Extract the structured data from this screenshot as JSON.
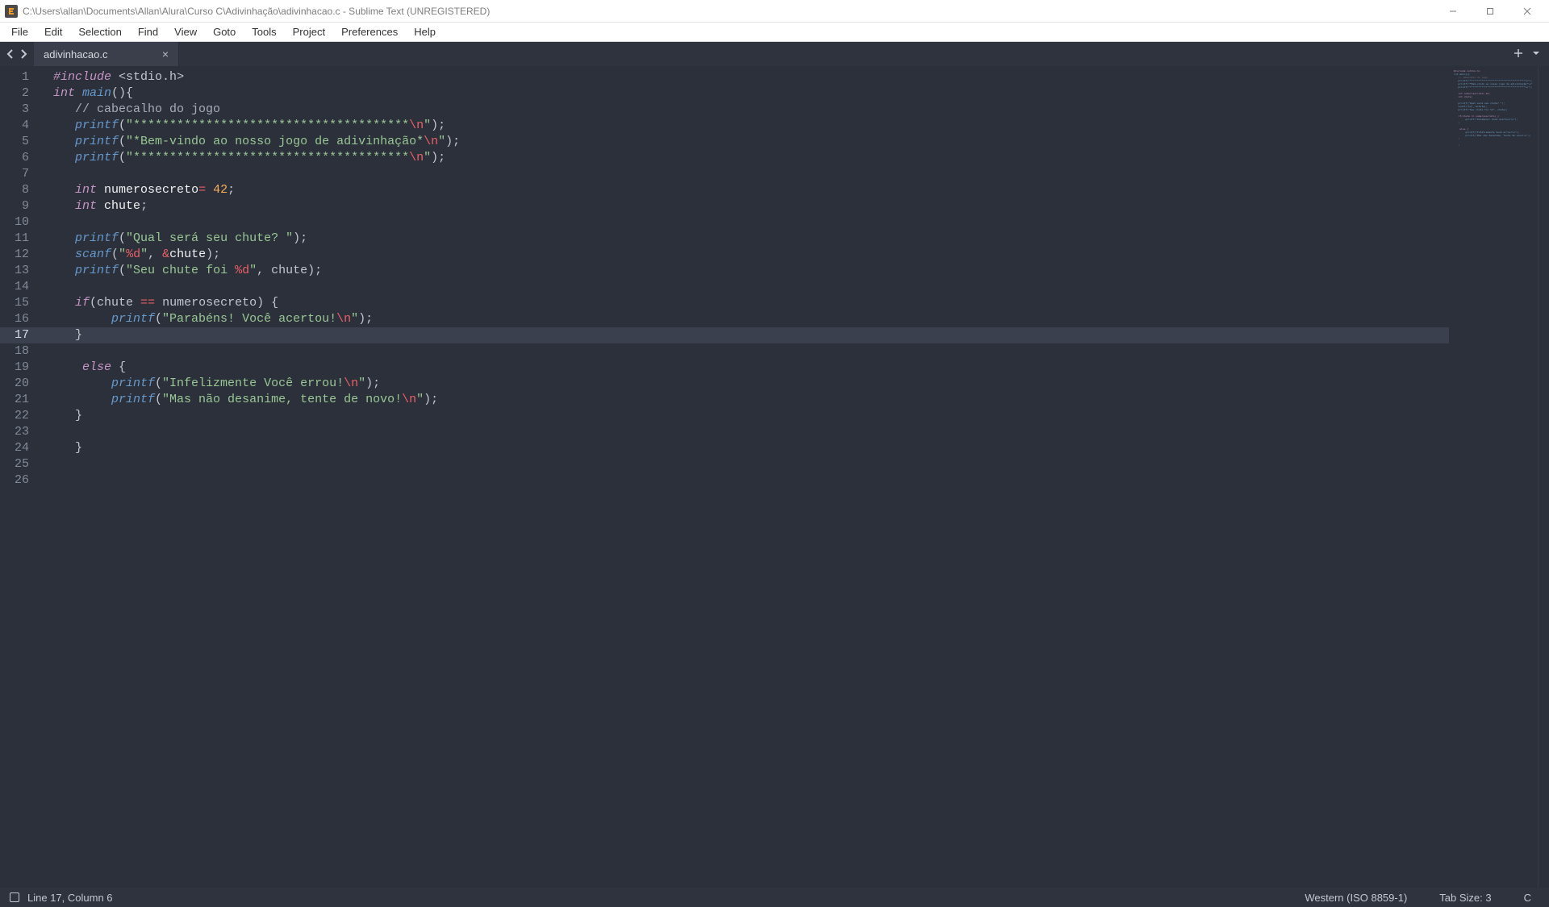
{
  "window": {
    "title": "C:\\Users\\allan\\Documents\\Allan\\Alura\\Curso C\\Adivinhação\\adivinhacao.c - Sublime Text (UNREGISTERED)"
  },
  "menu": {
    "items": [
      "File",
      "Edit",
      "Selection",
      "Find",
      "View",
      "Goto",
      "Tools",
      "Project",
      "Preferences",
      "Help"
    ]
  },
  "tabs": {
    "active": {
      "label": "adivinhacao.c"
    }
  },
  "editor": {
    "line_count": 26,
    "current_line": 17,
    "code_tokens": [
      [
        {
          "c": "pre",
          "t": "#include"
        },
        {
          "c": "pun",
          "t": " "
        },
        {
          "c": "pun",
          "t": "<"
        },
        {
          "c": "inc",
          "t": "stdio.h"
        },
        {
          "c": "pun",
          "t": ">"
        }
      ],
      [
        {
          "c": "kw",
          "t": "int"
        },
        {
          "c": "pun",
          "t": " "
        },
        {
          "c": "fn",
          "t": "main"
        },
        {
          "c": "pun",
          "t": "(){"
        }
      ],
      [
        {
          "c": "pun",
          "t": "   "
        },
        {
          "c": "cmt",
          "t": "// cabecalho do jogo"
        }
      ],
      [
        {
          "c": "pun",
          "t": "   "
        },
        {
          "c": "fn",
          "t": "printf"
        },
        {
          "c": "pun",
          "t": "("
        },
        {
          "c": "str",
          "t": "\"**************************************"
        },
        {
          "c": "esc",
          "t": "\\n"
        },
        {
          "c": "str",
          "t": "\""
        },
        {
          "c": "pun",
          "t": ");"
        }
      ],
      [
        {
          "c": "pun",
          "t": "   "
        },
        {
          "c": "fn",
          "t": "printf"
        },
        {
          "c": "pun",
          "t": "("
        },
        {
          "c": "str",
          "t": "\"*Bem-vindo ao nosso jogo de adivinhação*"
        },
        {
          "c": "esc",
          "t": "\\n"
        },
        {
          "c": "str",
          "t": "\""
        },
        {
          "c": "pun",
          "t": ");"
        }
      ],
      [
        {
          "c": "pun",
          "t": "   "
        },
        {
          "c": "fn",
          "t": "printf"
        },
        {
          "c": "pun",
          "t": "("
        },
        {
          "c": "str",
          "t": "\"**************************************"
        },
        {
          "c": "esc",
          "t": "\\n"
        },
        {
          "c": "str",
          "t": "\""
        },
        {
          "c": "pun",
          "t": ");"
        }
      ],
      [],
      [
        {
          "c": "pun",
          "t": "   "
        },
        {
          "c": "kw",
          "t": "int"
        },
        {
          "c": "pun",
          "t": " "
        },
        {
          "c": "ident",
          "t": "numerosecreto"
        },
        {
          "c": "op",
          "t": "="
        },
        {
          "c": "pun",
          "t": " "
        },
        {
          "c": "num",
          "t": "42"
        },
        {
          "c": "pun",
          "t": ";"
        }
      ],
      [
        {
          "c": "pun",
          "t": "   "
        },
        {
          "c": "kw",
          "t": "int"
        },
        {
          "c": "pun",
          "t": " "
        },
        {
          "c": "ident",
          "t": "chute"
        },
        {
          "c": "pun",
          "t": ";"
        }
      ],
      [],
      [
        {
          "c": "pun",
          "t": "   "
        },
        {
          "c": "fn",
          "t": "printf"
        },
        {
          "c": "pun",
          "t": "("
        },
        {
          "c": "str",
          "t": "\"Qual será seu chute? \""
        },
        {
          "c": "pun",
          "t": ");"
        }
      ],
      [
        {
          "c": "pun",
          "t": "   "
        },
        {
          "c": "fn",
          "t": "scanf"
        },
        {
          "c": "pun",
          "t": "("
        },
        {
          "c": "str",
          "t": "\""
        },
        {
          "c": "esc",
          "t": "%d"
        },
        {
          "c": "str",
          "t": "\""
        },
        {
          "c": "pun",
          "t": ", "
        },
        {
          "c": "op",
          "t": "&"
        },
        {
          "c": "ident",
          "t": "chute"
        },
        {
          "c": "pun",
          "t": ");"
        }
      ],
      [
        {
          "c": "pun",
          "t": "   "
        },
        {
          "c": "fn",
          "t": "printf"
        },
        {
          "c": "pun",
          "t": "("
        },
        {
          "c": "str",
          "t": "\"Seu chute foi "
        },
        {
          "c": "esc",
          "t": "%d"
        },
        {
          "c": "str",
          "t": "\""
        },
        {
          "c": "pun",
          "t": ", "
        },
        {
          "c": "identdim",
          "t": "chute"
        },
        {
          "c": "pun",
          "t": ");"
        }
      ],
      [],
      [
        {
          "c": "pun",
          "t": "   "
        },
        {
          "c": "kw",
          "t": "if"
        },
        {
          "c": "pun",
          "t": "(chute "
        },
        {
          "c": "op",
          "t": "=="
        },
        {
          "c": "pun",
          "t": " numerosecreto) {"
        }
      ],
      [
        {
          "c": "pun",
          "t": "        "
        },
        {
          "c": "fn",
          "t": "printf"
        },
        {
          "c": "pun",
          "t": "("
        },
        {
          "c": "str",
          "t": "\"Parabéns! Você acertou!"
        },
        {
          "c": "esc",
          "t": "\\n"
        },
        {
          "c": "str",
          "t": "\""
        },
        {
          "c": "pun",
          "t": ");"
        }
      ],
      [
        {
          "c": "pun",
          "t": "   }"
        }
      ],
      [],
      [
        {
          "c": "pun",
          "t": "    "
        },
        {
          "c": "kw",
          "t": "else"
        },
        {
          "c": "pun",
          "t": " {"
        }
      ],
      [
        {
          "c": "pun",
          "t": "        "
        },
        {
          "c": "fn",
          "t": "printf"
        },
        {
          "c": "pun",
          "t": "("
        },
        {
          "c": "str",
          "t": "\"Infelizmente Você errou!"
        },
        {
          "c": "esc",
          "t": "\\n"
        },
        {
          "c": "str",
          "t": "\""
        },
        {
          "c": "pun",
          "t": ");"
        }
      ],
      [
        {
          "c": "pun",
          "t": "        "
        },
        {
          "c": "fn",
          "t": "printf"
        },
        {
          "c": "pun",
          "t": "("
        },
        {
          "c": "str",
          "t": "\"Mas não desanime, tente de novo!"
        },
        {
          "c": "esc",
          "t": "\\n"
        },
        {
          "c": "str",
          "t": "\""
        },
        {
          "c": "pun",
          "t": ");"
        }
      ],
      [
        {
          "c": "pun",
          "t": "   }"
        }
      ],
      [],
      [
        {
          "c": "pun",
          "t": "   }"
        }
      ],
      [],
      []
    ]
  },
  "status": {
    "cursor": "Line 17, Column 6",
    "encoding": "Western (ISO 8859-1)",
    "tabsize": "Tab Size: 3",
    "syntax": "C"
  }
}
